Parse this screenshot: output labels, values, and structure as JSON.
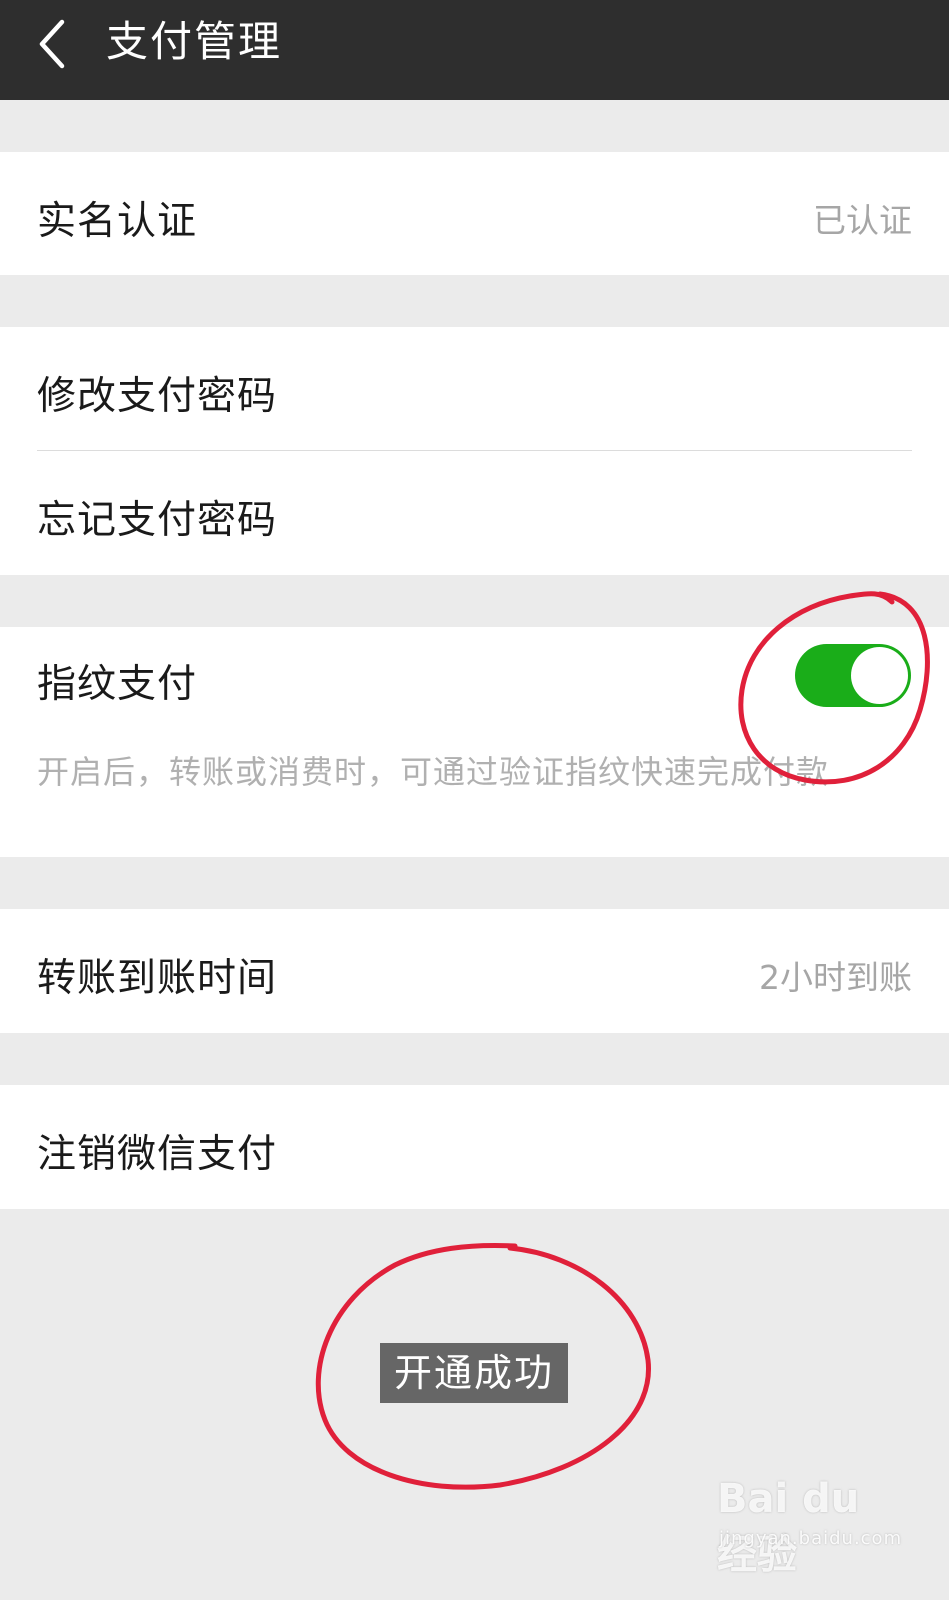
{
  "header": {
    "title": "支付管理",
    "back_icon": "chevron-left-icon"
  },
  "sections": {
    "verification": {
      "label": "实名认证",
      "value": "已认证"
    },
    "change_password": {
      "label": "修改支付密码"
    },
    "forgot_password": {
      "label": "忘记支付密码"
    },
    "fingerprint": {
      "label": "指纹支付",
      "enabled": true,
      "description": "开启后，转账或消费时，可通过验证指纹快速完成付款"
    },
    "transfer_time": {
      "label": "转账到账时间",
      "value": "2小时到账"
    },
    "cancel_pay": {
      "label": "注销微信支付"
    }
  },
  "toast": {
    "text": "开通成功"
  },
  "watermark": {
    "logo": "Bai du 经验",
    "url": "jingyan.baidu.com"
  },
  "colors": {
    "header_bg": "#2e2e2e",
    "toggle_on": "#1aad19",
    "annotation": "#e0203a",
    "background": "#ebebeb"
  }
}
